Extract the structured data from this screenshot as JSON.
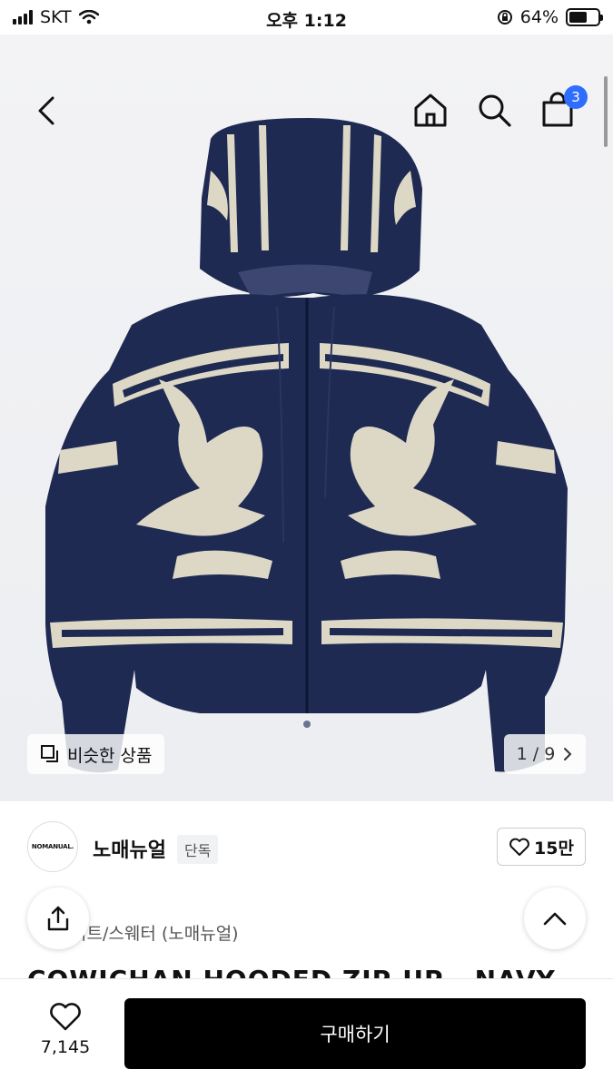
{
  "status_bar": {
    "carrier": "SKT",
    "time": "오후 1:12",
    "battery": "64%",
    "battery_level": 0.64
  },
  "nav": {
    "cart_count": "3",
    "icons": [
      "chevron-left-icon",
      "home-icon",
      "search-icon",
      "shopping-bag-icon"
    ]
  },
  "gallery": {
    "similar_label": "비슷한 상품",
    "page": "1 / 9"
  },
  "brand": {
    "logo_text": "NOMANUAL.",
    "name": "노매뉴얼",
    "badge": "단독",
    "likes": "15만"
  },
  "product": {
    "category": "니트/스웨터 (노매뉴얼)",
    "title": "COWICHAN HOODED ZIP-UP - NAVY"
  },
  "bottom": {
    "wish_count": "7,145",
    "buy_label": "구매하기"
  },
  "colors": {
    "navy": "#1e2a52",
    "cream": "#ddd8c6",
    "accent": "#2f6dff",
    "buy": "#000000"
  }
}
